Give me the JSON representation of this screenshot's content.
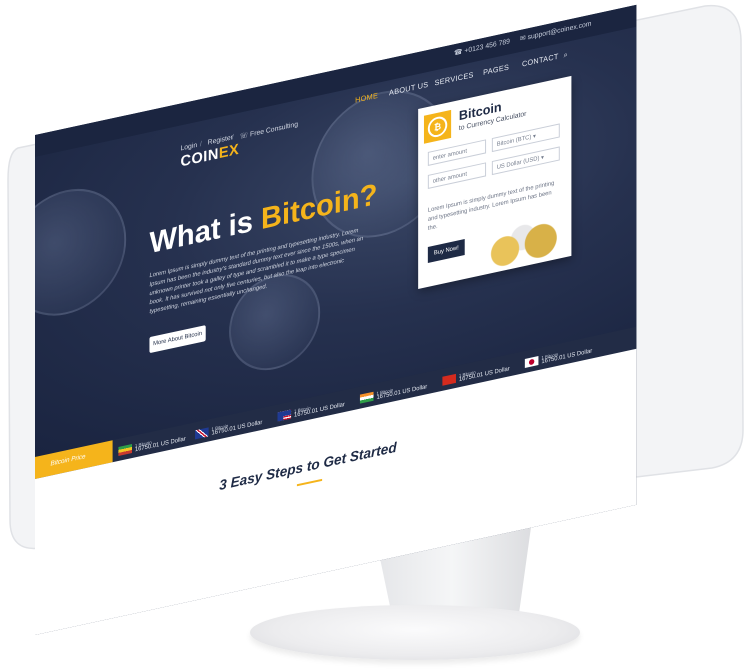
{
  "topbar": {
    "phone": "+0123 456 789",
    "email": "support@coinex.com"
  },
  "nav": {
    "login": "Login",
    "register": "Register",
    "consulting": "Free Consulting",
    "items": [
      "HOME",
      "ABOUT US",
      "SERVICES",
      "PAGES",
      "CONTACT"
    ]
  },
  "logo": {
    "main": "COIN",
    "accent": "EX"
  },
  "hero": {
    "headline_a": "What is ",
    "headline_b": "Bitcoin?",
    "body": "Lorem Ipsum is simply dummy text of the printing and typesetting industry. Lorem Ipsum has been the industry's standard dummy text ever since the 1500s, when an unknown printer took a galley of type and scrambled it to make a type specimen book. It has survived not only five centuries, but also the leap into electronic typesetting, remaining essentially unchanged.",
    "button": "More About Bitcoin"
  },
  "calculator": {
    "title": "Bitcoin",
    "subtitle": "to Currency Calculator",
    "amount_placeholder": "enter amount",
    "from_currency": "Bitcoin (BTC)",
    "other_placeholder": "other amount",
    "to_currency": "US Dollar (USD)",
    "description": "Lorem Ipsum is simply dummy text of the printing and typesetting industry. Lorem Ipsum has been the.",
    "buy": "Buy Now!"
  },
  "ticker": {
    "label": "Bitcoin Price",
    "items": [
      {
        "flag": "flag-icon-green-yellow",
        "label": "1 Bitcoin",
        "value": "16750.01 US Dollar"
      },
      {
        "flag": "flag-icon-uk",
        "label": "1 Bitcoin",
        "value": "16750.01 US Dollar"
      },
      {
        "flag": "flag-icon-us",
        "label": "1 Bitcoin",
        "value": "16750.01 US Dollar"
      },
      {
        "flag": "flag-icon-india",
        "label": "1 Bitcoin",
        "value": "16750.01 US Dollar"
      },
      {
        "flag": "flag-icon-china",
        "label": "1 Bitcoin",
        "value": "16750.01 US Dollar"
      },
      {
        "flag": "flag-icon-japan",
        "label": "1 Bitcoin",
        "value": "16750.01 US Dollar"
      }
    ]
  },
  "section": {
    "title": "3 Easy Steps to Get Started"
  },
  "colors": {
    "accent": "#f5b41b",
    "navy": "#1e2a45"
  }
}
